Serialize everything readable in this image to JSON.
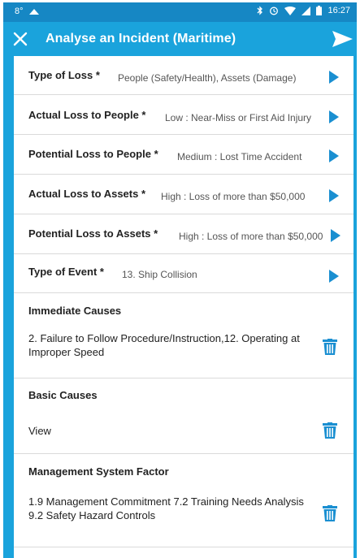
{
  "status_bar": {
    "temperature": "8°",
    "time": "16:27"
  },
  "app_bar": {
    "title": "Analyse an Incident (Maritime)"
  },
  "fields": [
    {
      "label": "Type of Loss *",
      "value": "People (Safety/Health), Assets (Damage)"
    },
    {
      "label": "Actual Loss to People *",
      "value": "Low : Near-Miss or First Aid Injury"
    },
    {
      "label": "Potential Loss to People *",
      "value": "Medium : Lost Time Accident"
    },
    {
      "label": "Actual Loss to Assets *",
      "value": "High : Loss of more than $50,000"
    },
    {
      "label": "Potential Loss to Assets *",
      "value": "High : Loss of more than $50,000"
    },
    {
      "label": "Type of Event *",
      "value": "13. Ship Collision"
    }
  ],
  "sections": [
    {
      "label": "Immediate Causes",
      "value": "2. Failure to Follow Procedure/Instruction,12. Operating at Improper Speed"
    },
    {
      "label": "Basic Causes",
      "value": "View"
    },
    {
      "label": "Management System Factor",
      "value": "1.9 Management Commitment 7.2 Training Needs Analysis 9.2 Safety Hazard Controls"
    }
  ],
  "colors": {
    "accent": "#1aa3dc",
    "status_bar": "#1687c4",
    "icon": "#1a8fd1"
  },
  "icons": [
    "close-icon",
    "send-icon",
    "chevron-right-icon",
    "trash-icon",
    "bluetooth-icon",
    "alarm-icon",
    "wifi-icon",
    "signal-icon",
    "battery-icon",
    "cloud-icon"
  ]
}
